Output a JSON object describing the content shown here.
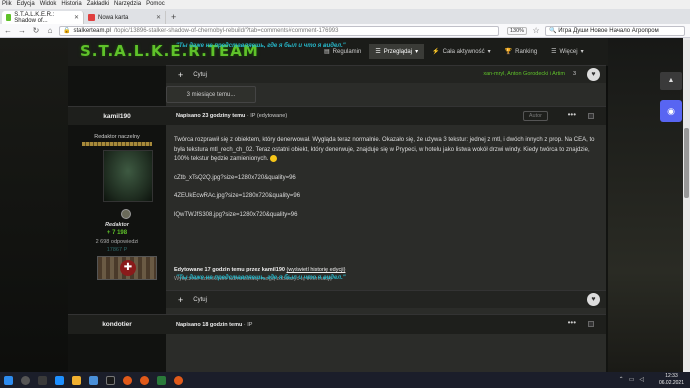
{
  "menubar": [
    "Plik",
    "Edycja",
    "Widok",
    "Historia",
    "Zakładki",
    "Narzędzia",
    "Pomoc"
  ],
  "tabs": [
    {
      "label": "S.T.A.L.K.E.R.: Shadow of...",
      "active": true
    },
    {
      "label": "Nowa karta",
      "active": false
    }
  ],
  "newtab_icon": "+",
  "address": {
    "domain": "stalkerteam.pl",
    "path": "/topic/13896-stalker-shadow-of-chernobyl-rebuild/?tab=comments#comment-176993",
    "zoom": "130%"
  },
  "search": {
    "value": "Игра Души Новое Начало Агропром"
  },
  "site": {
    "logo": "S.T.A.L.K.E.R.TEAM",
    "nav": [
      {
        "label": "Regulamin",
        "icon": "document-icon",
        "active": false
      },
      {
        "label": "Przeglądaj",
        "icon": "list-icon",
        "active": true,
        "caret": "▾"
      },
      {
        "label": "Cała aktywność",
        "icon": "activity-icon",
        "active": false,
        "caret": "▾"
      },
      {
        "label": "Ranking",
        "icon": "trophy-icon",
        "active": false
      },
      {
        "label": "Więcej",
        "icon": "menu-icon",
        "active": false,
        "caret": "▾"
      }
    ]
  },
  "prev_post": {
    "quote": "\"Ты даже не представляешь, где я был и что я видел.\"",
    "quote_action": "Cytuj",
    "reactions": {
      "users": "xan-mryl, Anton Gorodecki i Artim",
      "count": "3"
    },
    "colors": {
      "user1": "#5fc22a",
      "user2": "#e07020",
      "user3": "#5fc22a"
    }
  },
  "separator": "3 miesiące temu...",
  "post": {
    "author": "kamil190",
    "posted": "Napisano 23 godziny temu",
    "ip": "IP",
    "edited_flag": "(edytowane)",
    "author_badge": "Autor",
    "rank": "Redaktor naczelny",
    "group": "Redaktor",
    "reputation": "7 198",
    "reputation_icon": "+",
    "post_count": "2 698 odpowiedzi",
    "xp": "17867 P",
    "paragraph": "Twórca rozprawił się z obiektem, który denerwował. Wygląda teraz normalnie. Okazało się, że używa 3 tekstur: jednej z mtl, i dwóch innych z prop. Na CEA, to była tekstura mtl_rech_ch_02. Teraz ostatni obiekt, który denerwuje, znajduje się w Prypeci, w hotelu jako listwa wokół drzwi windy. Kiedy twórca to znajdzie, 100% tekstur będzie zamienionych.",
    "img1": "cZtb_xTsQ2Q.jpg?size=1280x720&quality=96",
    "img2": "4ZEUkEcwRAc.jpg?size=1280x720&quality=96",
    "img3": "lQwTWJfS308.jpg?size=1280x720&quality=96",
    "edited_by": "Edytowane 17 godzin temu przez kamil190",
    "edit_history": "(wyświetl historię edycji)",
    "mod_note": "Wyłącznie członkowie administracji mogą zobaczyć tę informację",
    "quote": "\"Ты даже не представляешь, где я был и что я видел.\"",
    "quote_action": "Cytuj"
  },
  "next_post": {
    "author": "kondotier",
    "posted": "Napisano 18 godzin temu",
    "ip": "IP"
  },
  "taskbar": {
    "time": "12:33",
    "date": "06.02.2021"
  }
}
